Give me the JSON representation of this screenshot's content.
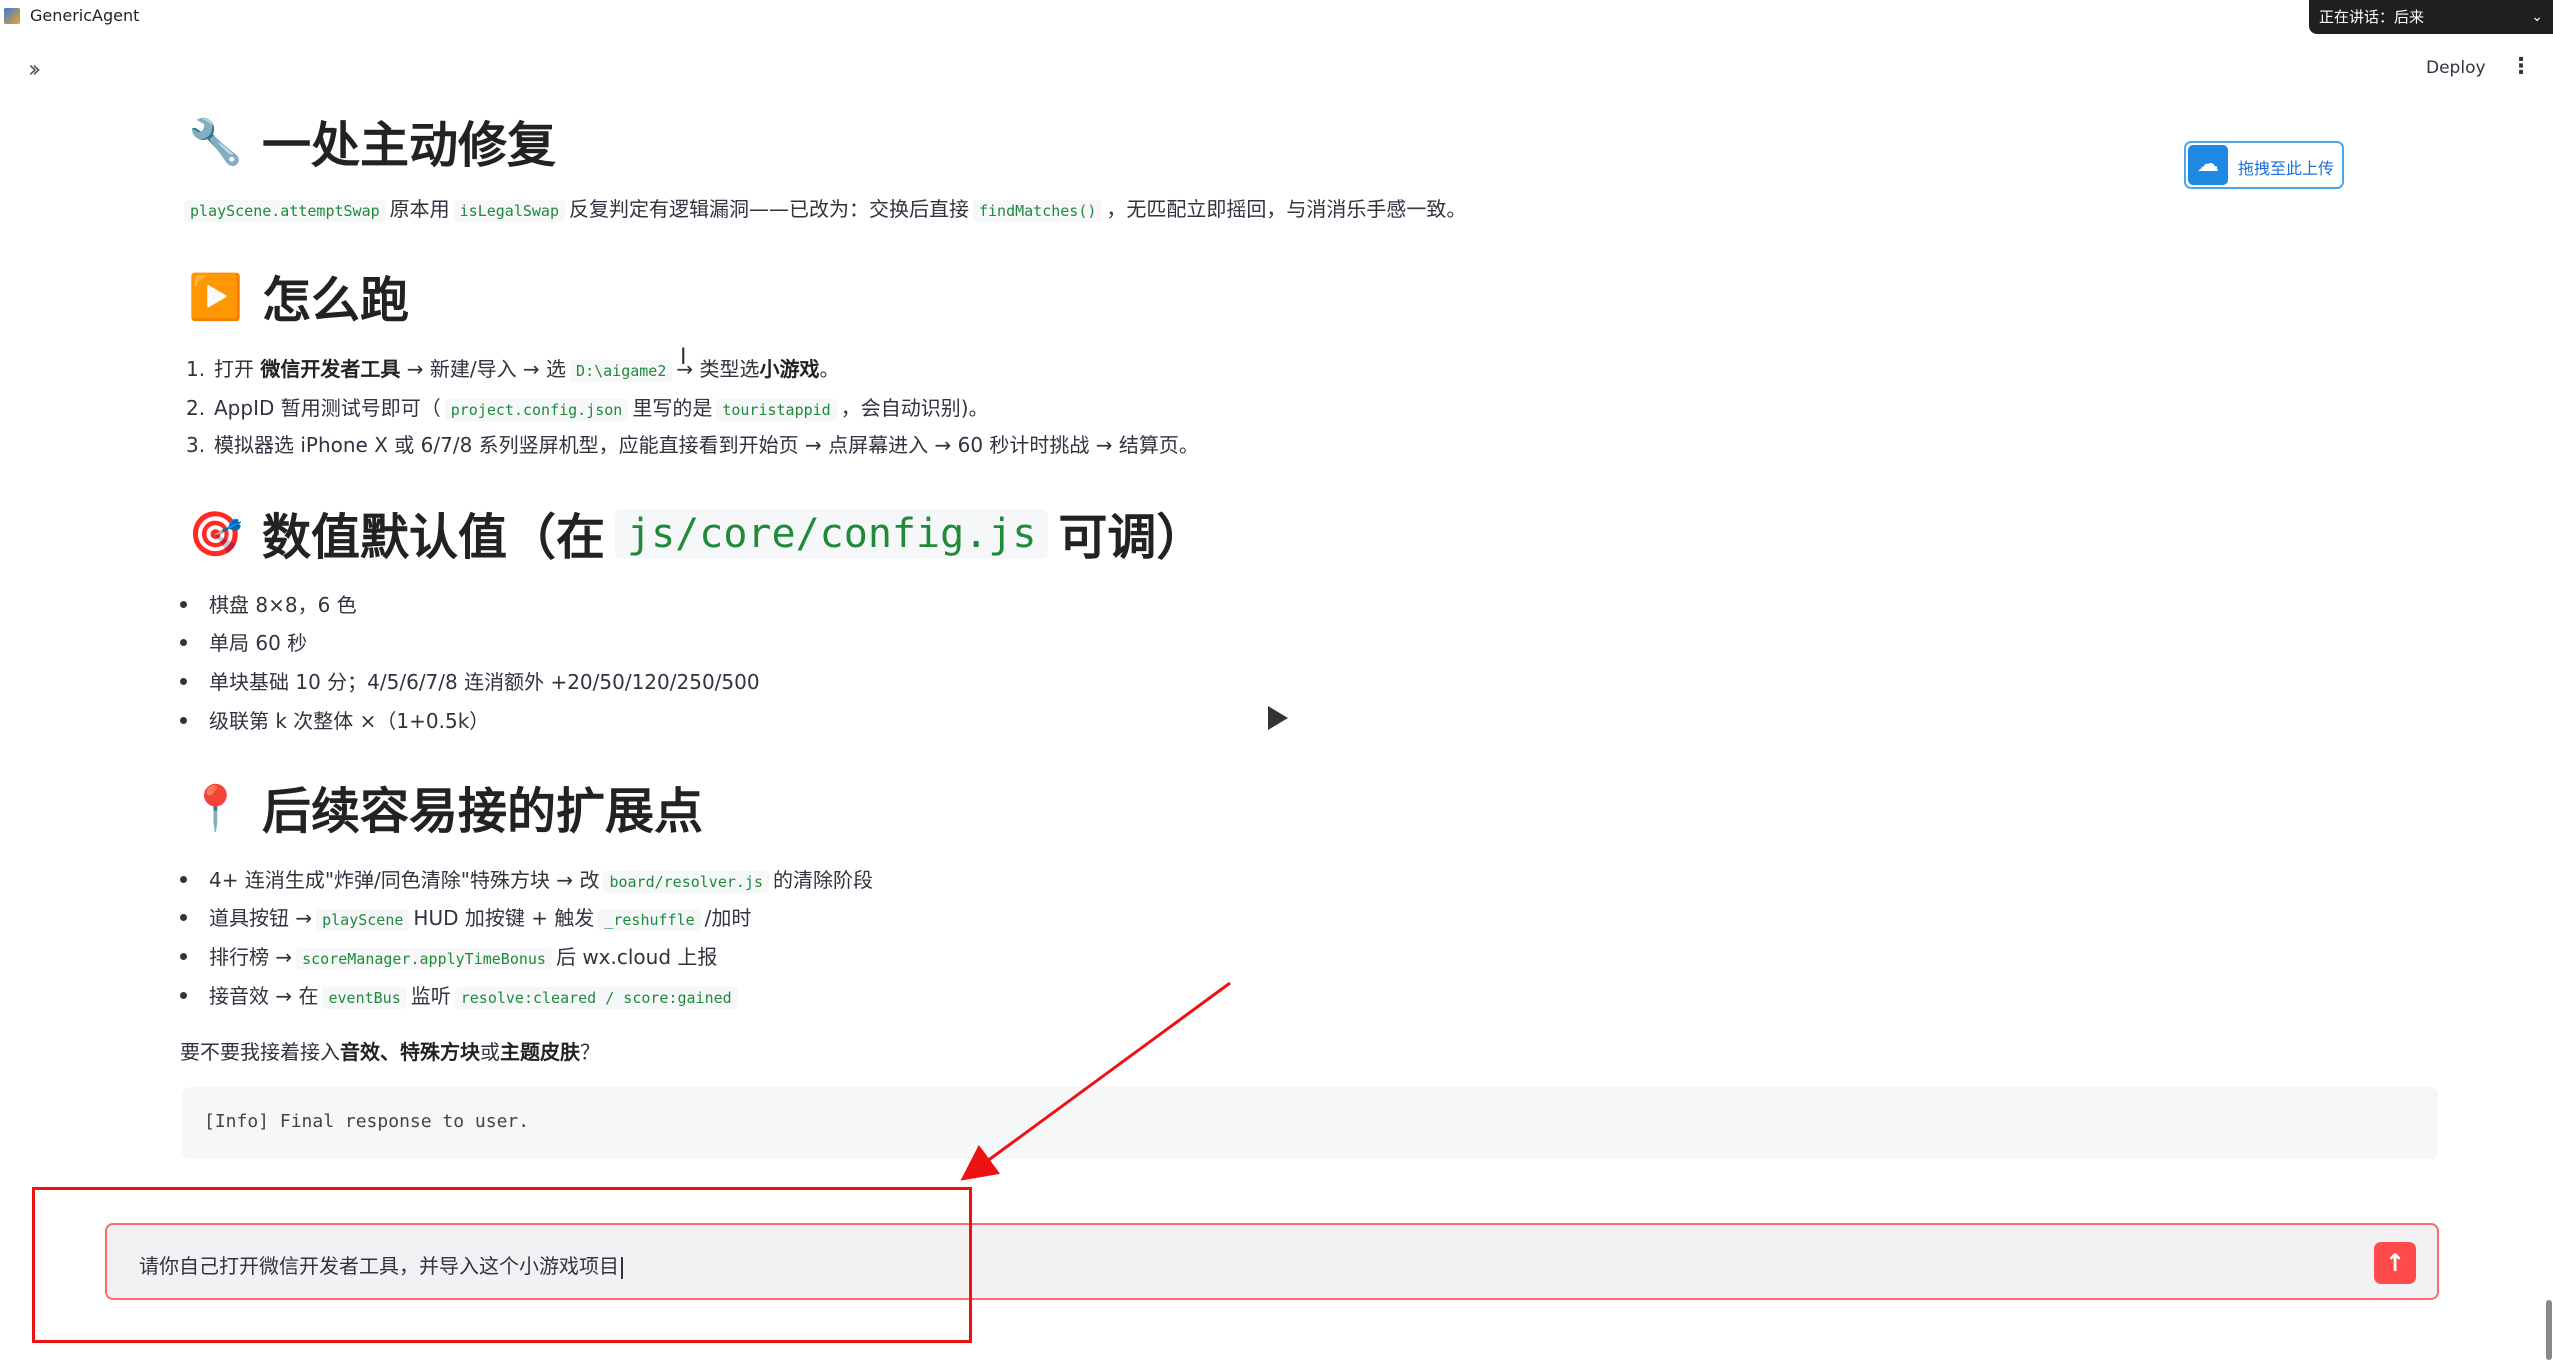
{
  "window": {
    "title": "GenericAgent",
    "speaking_label": "正在讲话：后来"
  },
  "header": {
    "deploy_label": "Deploy",
    "menu_icon": "⋮"
  },
  "upload_button": {
    "label": "拖拽至此上传"
  },
  "sections": {
    "fix": {
      "emoji": "🔧",
      "title": "一处主动修复",
      "code1": "playScene.attemptSwap",
      "text1": "原本用",
      "code2": "isLegalSwap",
      "text2": "反复判定有逻辑漏洞——已改为：交换后直接",
      "code3": "findMatches()",
      "text3": "，无匹配立即摇回，与消消乐手感一致。"
    },
    "run": {
      "emoji": "▶️",
      "title": "怎么跑",
      "item1_a": "打开",
      "item1_b": "微信开发者工具",
      "item1_c": "→ 新建/导入 → 选",
      "item1_code": "D:\\aigame2",
      "item1_d": "→ 类型选",
      "item1_e": "小游戏",
      "item1_f": "。",
      "item2_a": "AppID 暂用测试号即可（",
      "item2_code1": "project.config.json",
      "item2_b": "里写的是",
      "item2_code2": "touristappid",
      "item2_c": "，会自动识别)。",
      "item3": "模拟器选 iPhone X 或 6/7/8 系列竖屏机型，应能直接看到开始页 → 点屏幕进入 → 60 秒计时挑战 → 结算页。"
    },
    "defaults": {
      "emoji": "🎯",
      "title_a": "数值默认值（在",
      "title_code": "js/core/config.js",
      "title_b": "可调）",
      "items": [
        "棋盘 8×8，6 色",
        "单局 60 秒",
        "单块基础 10 分；4/5/6/7/8 连消额外 +20/50/120/250/500",
        "级联第 k 次整体 ×（1+0.5k）"
      ]
    },
    "ext": {
      "emoji": "📍",
      "title": "后续容易接的扩展点",
      "item1_a": "4+ 连消生成\"炸弹/同色清除\"特殊方块 → 改",
      "item1_code": "board/resolver.js",
      "item1_b": "的清除阶段",
      "item2_a": "道具按钮 →",
      "item2_code1": "playScene",
      "item2_b": "HUD 加按键 + 触发",
      "item2_code2": "_reshuffle",
      "item2_c": "/加时",
      "item3_a": "排行榜 →",
      "item3_code": "scoreManager.applyTimeBonus",
      "item3_b": "后 wx.cloud 上报",
      "item4_a": "接音效 → 在",
      "item4_code1": "eventBus",
      "item4_b": "监听",
      "item4_code2": "resolve:cleared / score:gained"
    },
    "question": {
      "a": "要不要我接着接入",
      "b": "音效、特殊方块",
      "c": "或",
      "d": "主题皮肤",
      "e": "？"
    }
  },
  "info_box": {
    "text": "[Info] Final response to user."
  },
  "chat_input": {
    "value": "请你自己打开微信开发者工具，并导入这个小游戏项目"
  },
  "colors": {
    "accent": "#ff4b4b",
    "annotation": "#e11111",
    "code_text": "#1f8a3a",
    "upload_blue": "#1e88e5"
  }
}
